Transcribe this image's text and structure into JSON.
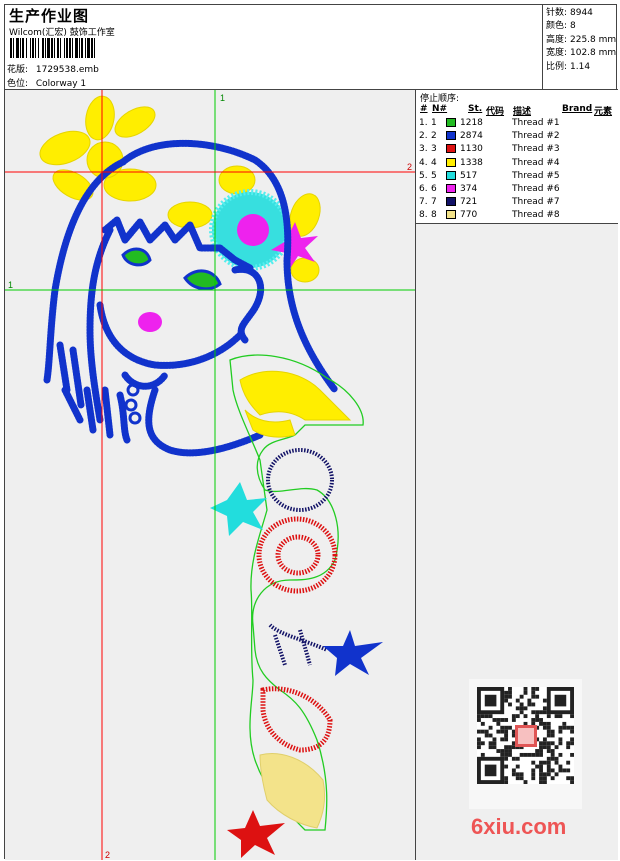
{
  "header": {
    "title": "生产作业图",
    "studio": "Wilcom(汇宏) 鼓饰工作室",
    "file_label": "花版:",
    "file_value": "1729538.emb",
    "colorway_label": "色位:",
    "colorway_value": "Colorway 1"
  },
  "stats": [
    {
      "label": "针数:",
      "value": "8944"
    },
    {
      "label": "颜色:",
      "value": "8"
    },
    {
      "label": "高度:",
      "value": "225.8 mm"
    },
    {
      "label": "宽度:",
      "value": "102.8 mm"
    },
    {
      "label": "比例:",
      "value": "1.14"
    }
  ],
  "stop_sequence": {
    "title": "停止顺序:",
    "columns": {
      "num": "#",
      "n": "N#",
      "st": "St.",
      "code": "代码",
      "desc": "描述",
      "brand": "Brand",
      "element": "元素"
    },
    "rows": [
      {
        "num": "1.",
        "n": "1",
        "color": "#22bb22",
        "st": "1218",
        "desc": "Thread #1"
      },
      {
        "num": "2.",
        "n": "2",
        "color": "#1133cc",
        "st": "2874",
        "desc": "Thread #2"
      },
      {
        "num": "3.",
        "n": "3",
        "color": "#dd1111",
        "st": "1130",
        "desc": "Thread #3"
      },
      {
        "num": "4.",
        "n": "4",
        "color": "#ffee00",
        "st": "1338",
        "desc": "Thread #4"
      },
      {
        "num": "5.",
        "n": "5",
        "color": "#22dddd",
        "st": "517",
        "desc": "Thread #5"
      },
      {
        "num": "6.",
        "n": "6",
        "color": "#ee22ee",
        "st": "374",
        "desc": "Thread #6"
      },
      {
        "num": "7.",
        "n": "7",
        "color": "#111166",
        "st": "721",
        "desc": "Thread #7"
      },
      {
        "num": "8.",
        "n": "8",
        "color": "#f3e38a",
        "st": "770",
        "desc": "Thread #8"
      }
    ]
  },
  "guides": {
    "v1_label": "1",
    "v2_label": "2",
    "h1_label": "1",
    "h2_label": "2"
  },
  "watermark": "6xiu.com",
  "colors": {
    "blue": "#1133cc",
    "red": "#dd1111",
    "yellow": "#ffee00",
    "cyan": "#22dddd",
    "magenta": "#ee22ee",
    "navy": "#111166",
    "green": "#22bb22",
    "guide_red": "#ff0000",
    "guide_green": "#00cc00"
  }
}
